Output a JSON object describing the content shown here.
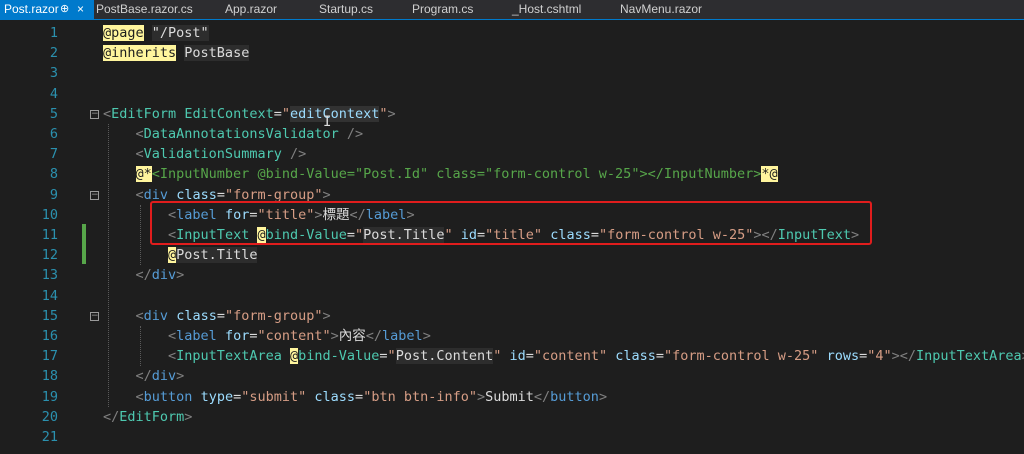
{
  "tabs": [
    {
      "label": "Post.razor",
      "pin": "⊕",
      "close": "×",
      "active": true
    },
    {
      "label": "PostBase.razor.cs"
    },
    {
      "label": "App.razor"
    },
    {
      "label": "Startup.cs"
    },
    {
      "label": "Program.cs"
    },
    {
      "label": "_Host.cshtml"
    },
    {
      "label": "NavMenu.razor"
    }
  ],
  "line_numbers": [
    "1",
    "2",
    "3",
    "4",
    "5",
    "6",
    "7",
    "8",
    "9",
    "10",
    "11",
    "12",
    "13",
    "14",
    "15",
    "16",
    "17",
    "18",
    "19",
    "20",
    "21"
  ],
  "code_lines": [
    [
      [
        "@page",
        "c-at"
      ],
      [
        " ",
        ""
      ],
      [
        "\"/Post\"",
        "c-str c-razor"
      ]
    ],
    [
      [
        "@inherits",
        "c-at"
      ],
      [
        " ",
        ""
      ],
      [
        "PostBase",
        "c-tag c-razor"
      ]
    ],
    [],
    [],
    [
      [
        "<",
        "c-bracket"
      ],
      [
        "EditForm",
        "c-tag"
      ],
      [
        " ",
        ""
      ],
      [
        "EditContext",
        "c-tag"
      ],
      [
        "=",
        "c-text"
      ],
      [
        "\"",
        "c-str"
      ],
      [
        "editContext",
        "c-raz-hl"
      ],
      [
        "\"",
        "c-str"
      ],
      [
        ">",
        "c-bracket"
      ]
    ],
    [
      [
        "    ",
        ""
      ],
      [
        "<",
        "c-bracket"
      ],
      [
        "DataAnnotationsValidator",
        "c-tag"
      ],
      [
        " />",
        "c-bracket"
      ]
    ],
    [
      [
        "    ",
        ""
      ],
      [
        "<",
        "c-bracket"
      ],
      [
        "ValidationSummary",
        "c-tag"
      ],
      [
        " />",
        "c-bracket"
      ]
    ],
    [
      [
        "    ",
        ""
      ],
      [
        "@*",
        "c-at"
      ],
      [
        "<InputNumber @bind-Value=\"Post.Id\" class=\"form-control w-25\"></InputNumber>",
        "c-comment"
      ],
      [
        "*@",
        "c-at"
      ]
    ],
    [
      [
        "    ",
        ""
      ],
      [
        "<",
        "c-bracket"
      ],
      [
        "div",
        "c-html"
      ],
      [
        " ",
        ""
      ],
      [
        "class",
        "c-attr"
      ],
      [
        "=",
        "c-text"
      ],
      [
        "\"form-group\"",
        "c-str"
      ],
      [
        ">",
        "c-bracket"
      ]
    ],
    [
      [
        "        ",
        ""
      ],
      [
        "<",
        "c-bracket"
      ],
      [
        "label",
        "c-html"
      ],
      [
        " ",
        ""
      ],
      [
        "for",
        "c-attr"
      ],
      [
        "=",
        "c-text"
      ],
      [
        "\"title\"",
        "c-str"
      ],
      [
        ">",
        "c-bracket"
      ],
      [
        "標題",
        "c-text"
      ],
      [
        "</",
        "c-bracket"
      ],
      [
        "label",
        "c-html"
      ],
      [
        ">",
        "c-bracket"
      ]
    ],
    [
      [
        "        ",
        ""
      ],
      [
        "<",
        "c-bracket"
      ],
      [
        "InputText",
        "c-tag"
      ],
      [
        " ",
        ""
      ],
      [
        "@",
        "c-at"
      ],
      [
        "bind-Value",
        "c-tag"
      ],
      [
        "=",
        "c-text"
      ],
      [
        "\"",
        "c-str"
      ],
      [
        "Post.Title",
        "c-razor"
      ],
      [
        "\"",
        "c-str"
      ],
      [
        " ",
        ""
      ],
      [
        "id",
        "c-attr"
      ],
      [
        "=",
        "c-text"
      ],
      [
        "\"title\"",
        "c-str"
      ],
      [
        " ",
        ""
      ],
      [
        "class",
        "c-attr"
      ],
      [
        "=",
        "c-text"
      ],
      [
        "\"form-control w-25\"",
        "c-str"
      ],
      [
        "></",
        "c-bracket"
      ],
      [
        "InputText",
        "c-tag"
      ],
      [
        ">",
        "c-bracket"
      ]
    ],
    [
      [
        "        ",
        ""
      ],
      [
        "@",
        "c-at"
      ],
      [
        "Post.Title",
        "c-razor"
      ]
    ],
    [
      [
        "    ",
        ""
      ],
      [
        "</",
        "c-bracket"
      ],
      [
        "div",
        "c-html"
      ],
      [
        ">",
        "c-bracket"
      ]
    ],
    [],
    [
      [
        "    ",
        ""
      ],
      [
        "<",
        "c-bracket"
      ],
      [
        "div",
        "c-html"
      ],
      [
        " ",
        ""
      ],
      [
        "class",
        "c-attr"
      ],
      [
        "=",
        "c-text"
      ],
      [
        "\"form-group\"",
        "c-str"
      ],
      [
        ">",
        "c-bracket"
      ]
    ],
    [
      [
        "        ",
        ""
      ],
      [
        "<",
        "c-bracket"
      ],
      [
        "label",
        "c-html"
      ],
      [
        " ",
        ""
      ],
      [
        "for",
        "c-attr"
      ],
      [
        "=",
        "c-text"
      ],
      [
        "\"content\"",
        "c-str"
      ],
      [
        ">",
        "c-bracket"
      ],
      [
        "內容",
        "c-text"
      ],
      [
        "</",
        "c-bracket"
      ],
      [
        "label",
        "c-html"
      ],
      [
        ">",
        "c-bracket"
      ]
    ],
    [
      [
        "        ",
        ""
      ],
      [
        "<",
        "c-bracket"
      ],
      [
        "InputTextArea",
        "c-tag"
      ],
      [
        " ",
        ""
      ],
      [
        "@",
        "c-at"
      ],
      [
        "bind-Value",
        "c-tag"
      ],
      [
        "=",
        "c-text"
      ],
      [
        "\"",
        "c-str"
      ],
      [
        "Post.Content",
        "c-razor"
      ],
      [
        "\"",
        "c-str"
      ],
      [
        " ",
        ""
      ],
      [
        "id",
        "c-attr"
      ],
      [
        "=",
        "c-text"
      ],
      [
        "\"content\"",
        "c-str"
      ],
      [
        " ",
        ""
      ],
      [
        "class",
        "c-attr"
      ],
      [
        "=",
        "c-text"
      ],
      [
        "\"form-control w-25\"",
        "c-str"
      ],
      [
        " ",
        ""
      ],
      [
        "rows",
        "c-attr"
      ],
      [
        "=",
        "c-text"
      ],
      [
        "\"4\"",
        "c-str"
      ],
      [
        "></",
        "c-bracket"
      ],
      [
        "InputTextArea",
        "c-tag"
      ],
      [
        ">",
        "c-bracket"
      ]
    ],
    [
      [
        "    ",
        ""
      ],
      [
        "</",
        "c-bracket"
      ],
      [
        "div",
        "c-html"
      ],
      [
        ">",
        "c-bracket"
      ]
    ],
    [
      [
        "    ",
        ""
      ],
      [
        "<",
        "c-bracket"
      ],
      [
        "button",
        "c-html"
      ],
      [
        " ",
        ""
      ],
      [
        "type",
        "c-attr"
      ],
      [
        "=",
        "c-text"
      ],
      [
        "\"submit\"",
        "c-str"
      ],
      [
        " ",
        ""
      ],
      [
        "class",
        "c-attr"
      ],
      [
        "=",
        "c-text"
      ],
      [
        "\"btn btn-info\"",
        "c-str"
      ],
      [
        ">",
        "c-bracket"
      ],
      [
        "Submit",
        "c-text"
      ],
      [
        "</",
        "c-bracket"
      ],
      [
        "button",
        "c-html"
      ],
      [
        ">",
        "c-bracket"
      ]
    ],
    [
      [
        "</",
        "c-bracket"
      ],
      [
        "EditForm",
        "c-tag"
      ],
      [
        ">",
        "c-bracket"
      ]
    ],
    []
  ],
  "fold_markers": [
    {
      "line": 5,
      "symbol": "−"
    },
    {
      "line": 9,
      "symbol": "−"
    },
    {
      "line": 15,
      "symbol": "−"
    }
  ],
  "cursor_icon": "text-cursor-icon",
  "colors": {
    "accent": "#007acc",
    "highlight_box": "#e11d1d",
    "change_bar": "#57a64a"
  }
}
